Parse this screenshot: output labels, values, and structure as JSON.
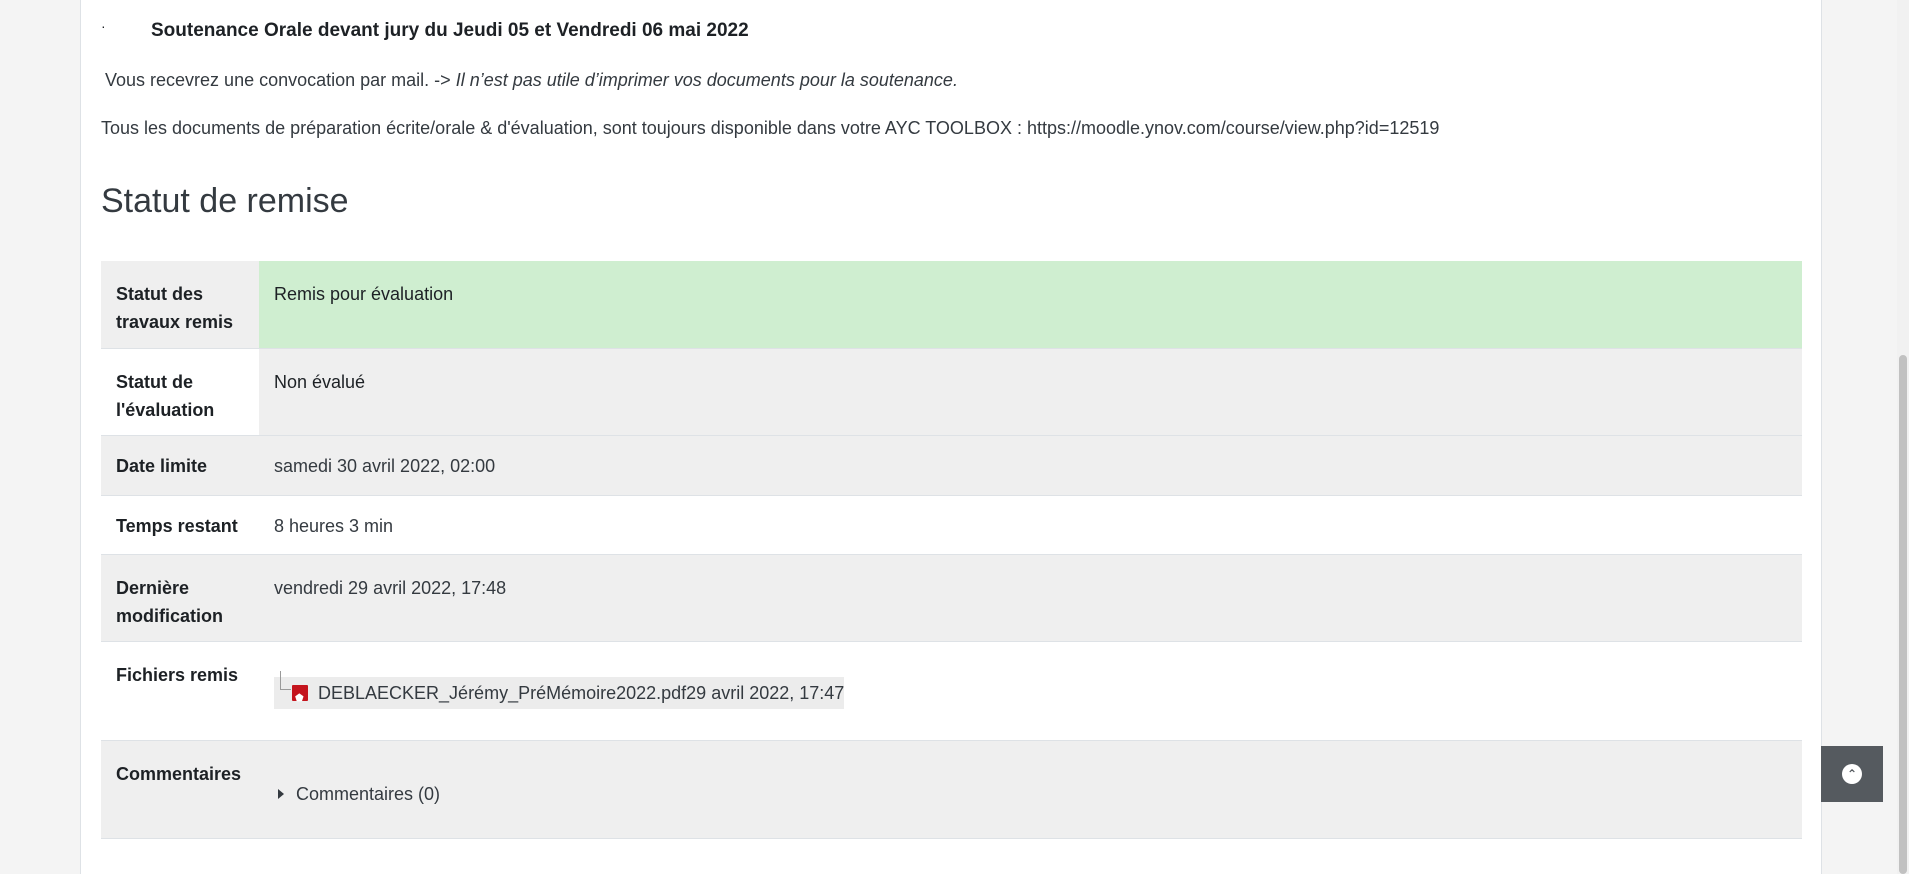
{
  "intro": {
    "bullet_symbol": "·",
    "soutenance_prefix": "Soutenance Orale devant jury du ",
    "soutenance_dates": "Jeudi 05 et Vendredi 06 mai 2022",
    "convocation_text": "Vous recevrez une convocation par mail. -> ",
    "convocation_italic": "Il n’est pas utile d’imprimer vos documents pour la soutenance.",
    "documents_text": "Tous les documents de préparation écrite/orale & d'évaluation, sont toujours disponible dans votre AYC TOOLBOX : https://moodle.ynov.com/course/view.php?id=12519"
  },
  "section_title": "Statut de remise",
  "status_table": {
    "submission_status": {
      "label": "Statut des travaux remis",
      "value": "Remis pour évaluation"
    },
    "grading_status": {
      "label": "Statut de l'évaluation",
      "value": "Non évalué"
    },
    "due_date": {
      "label": "Date limite",
      "value": "samedi 30 avril 2022, 02:00"
    },
    "time_remaining": {
      "label": "Temps restant",
      "value": "8 heures 3 min"
    },
    "last_modified": {
      "label": "Dernière modification",
      "value": "vendredi 29 avril 2022, 17:48"
    },
    "submitted_files": {
      "label": "Fichiers remis",
      "file_name": "DEBLAECKER_Jérémy_PréMémoire2022.pdf",
      "file_date": "29 avril 2022, 17:47",
      "icon": "pdf-icon"
    },
    "comments": {
      "label": "Commentaires",
      "toggle": "Commentaires (0)"
    }
  },
  "back_to_top": {
    "icon": "chevron-up-icon"
  },
  "colors": {
    "submitted_green": "#cfeed0",
    "row_gray": "#efefef",
    "pdf_red": "#c4141d",
    "back_to_top_bg": "#555a5f"
  }
}
